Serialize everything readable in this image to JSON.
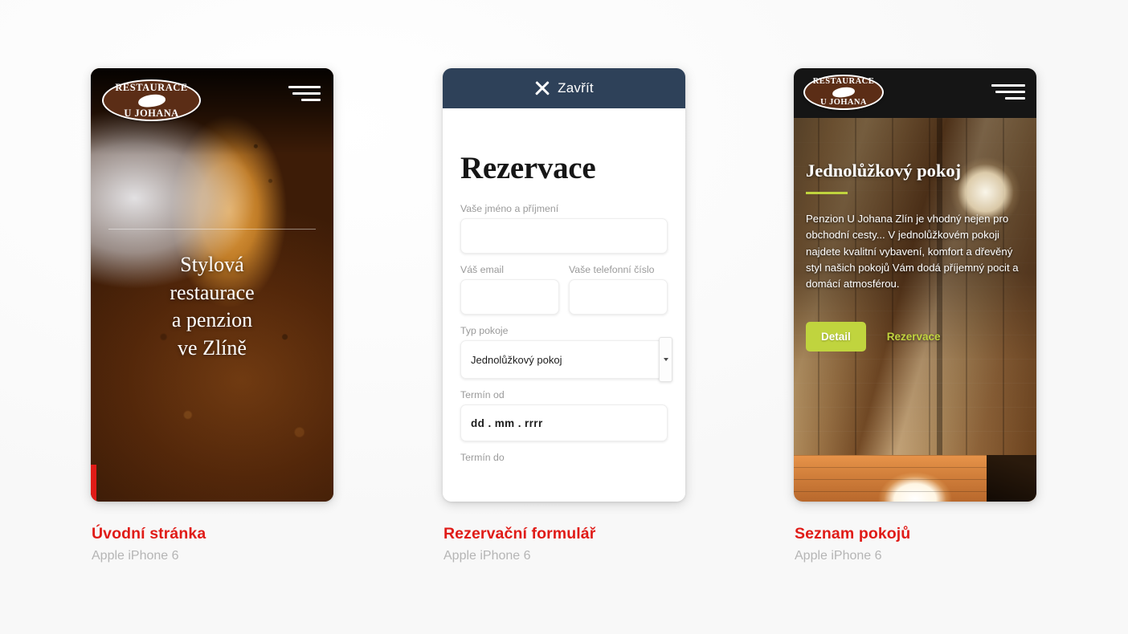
{
  "page": {
    "background_color": "#fdfdfd",
    "accent_red": "#e01b17",
    "accent_green": "#c0d43e",
    "header_navy": "#2e4159",
    "logo_brown": "#5b2d16"
  },
  "brand": {
    "logo_line1": "Restaurace",
    "logo_line2": "U Johana",
    "logo_icon": "ham-hock-icon"
  },
  "screens": [
    {
      "id": "homepage",
      "caption_title": "Úvodní stránka",
      "caption_subtitle": "Apple iPhone 6",
      "menu_icon": "hamburger-menu-icon",
      "hero_lines": [
        "Stylová",
        "restaurace",
        "a penzion",
        "ve Zlíně"
      ],
      "hero_text": "Stylová restaurace a penzion ve Zlíně"
    },
    {
      "id": "reservation-form",
      "caption_title": "Rezervační formulář",
      "caption_subtitle": "Apple iPhone 6",
      "header": {
        "close_icon": "close-x-icon",
        "close_label": "Zavřít"
      },
      "title": "Rezervace",
      "fields": [
        {
          "label": "Vaše jméno a příjmení",
          "value": "",
          "placeholder": "",
          "type": "text"
        },
        {
          "label": "Váš email",
          "value": "",
          "placeholder": "",
          "type": "email"
        },
        {
          "label": "Vaše telefonní číslo",
          "value": "",
          "placeholder": "",
          "type": "tel"
        },
        {
          "label": "Typ pokoje",
          "value": "Jednolůžkový pokoj",
          "type": "select"
        },
        {
          "label": "Termín od",
          "value": "dd . mm . rrrr",
          "type": "date"
        },
        {
          "label": "Termín do",
          "value": "",
          "type": "date"
        }
      ],
      "select_arrow_icon": "chevron-down-icon"
    },
    {
      "id": "room-list",
      "caption_title": "Seznam pokojů",
      "caption_subtitle": "Apple iPhone 6",
      "menu_icon": "hamburger-menu-icon",
      "room_title": "Jednolůžkový pokoj",
      "room_description": "Penzion U Johana Zlín je vhodný nejen pro obchodní cesty...\nV jednolůžkovém pokoji najdete kvalitní vybavení, komfort a dřevěný styl našich pokojů Vám dodá příjemný pocit a domácí atmosférou.",
      "detail_button": "Detail",
      "reserve_link": "Rezervace"
    }
  ]
}
